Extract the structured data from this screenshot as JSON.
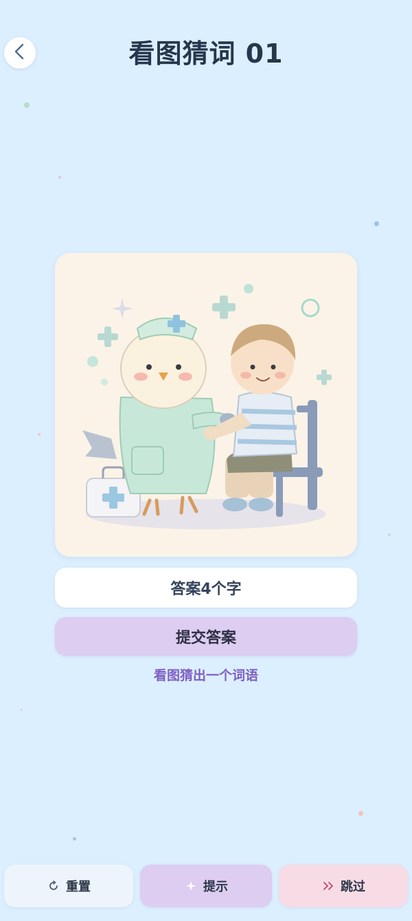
{
  "header": {
    "title": "看图猜词 01"
  },
  "answer_input": {
    "placeholder": "答案4个字",
    "value": ""
  },
  "submit_label": "提交答案",
  "instruction": "看图猜出一个词语",
  "bottom_actions": {
    "reset": {
      "label": "重置",
      "icon": "refresh-icon"
    },
    "hint": {
      "label": "提示",
      "icon": "sparkle-icon"
    },
    "skip": {
      "label": "跳过",
      "icon": "skip-icon"
    }
  },
  "colors": {
    "background": "#dcefff",
    "title": "#26374d",
    "accent_purple": "#dccdf1",
    "instruction": "#7e5fc2",
    "skip_pink": "#f7dce6"
  },
  "picture": {
    "description_icon": "nurse-bird-treating-boy-illustration"
  }
}
